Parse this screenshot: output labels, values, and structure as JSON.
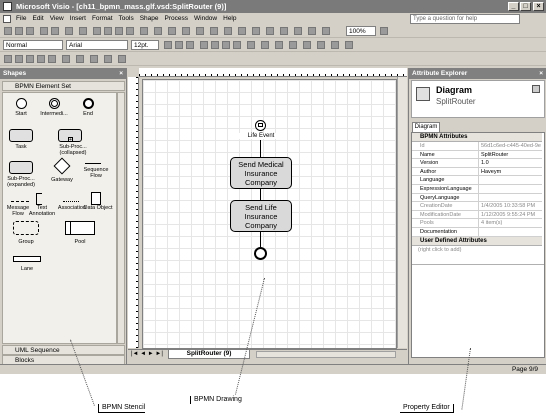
{
  "window": {
    "title": "Microsoft Visio - [ch11_bpmn_mass.glf.vsd:SplitRouter (9)]",
    "help_placeholder": "Type a question for help"
  },
  "menu": [
    "File",
    "Edit",
    "View",
    "Insert",
    "Format",
    "Tools",
    "Shape",
    "Process",
    "Window",
    "Help"
  ],
  "toolbar": {
    "style_value": "Normal",
    "font_value": "Arial",
    "size_value": "12pt.",
    "zoom_value": "100%"
  },
  "shapes_panel": {
    "title": "Shapes",
    "stencil_name": "BPMN Element Set",
    "items": {
      "start": "Start",
      "intermediate": "Intermedi...",
      "end": "End",
      "task": "Task",
      "subproc_collapsed": "Sub-Proc... (collapsed)",
      "subproc_expanded": "Sub-Proc... (expanded)",
      "gateway": "Gateway",
      "sequence_flow": "Sequence Flow",
      "message_flow": "Message Flow",
      "text_annotation": "Text Annotation",
      "association": "Association",
      "data_object": "Data Object",
      "group": "Group",
      "pool": "Pool",
      "lane": "Lane"
    },
    "uml_sequence": "UML Sequence",
    "blocks": "Blocks"
  },
  "drawing": {
    "start_event_label": "Life Event",
    "task1": "Send Medical Insurance Company",
    "task2": "Send Life Insurance Company",
    "page_tab": "SplitRouter (9)",
    "status_page": "Page 9/9"
  },
  "attribute_explorer": {
    "title": "Attribute Explorer",
    "object_type": "Diagram",
    "object_name": "SplitRouter",
    "tab": "Diagram",
    "section1": "BPMN Attributes",
    "rows": [
      {
        "k": "Id",
        "v": "56d1c6ed-c445-40ed-9e",
        "gray": true
      },
      {
        "k": "Name",
        "v": "SplitRouter",
        "gray": false
      },
      {
        "k": "Version",
        "v": "1.0",
        "gray": false
      },
      {
        "k": "Author",
        "v": "Haveym",
        "gray": false
      },
      {
        "k": "Language",
        "v": "",
        "gray": false
      },
      {
        "k": "ExpressionLanguage",
        "v": "",
        "gray": false
      },
      {
        "k": "QueryLanguage",
        "v": "",
        "gray": false
      },
      {
        "k": "CreationDate",
        "v": "1/4/2005 10:33:58 PM",
        "gray": true
      },
      {
        "k": "ModificationDate",
        "v": "1/12/2005 9:55:24 PM",
        "gray": true
      },
      {
        "k": "Pools",
        "v": "4 item(s)",
        "gray": true
      },
      {
        "k": "Documentation",
        "v": "",
        "gray": false
      }
    ],
    "section2": "User Defined Attributes",
    "add_hint": "(right click to add)"
  },
  "callouts": {
    "stencil": "BPMN Stencil",
    "drawing": "BPMN Drawing",
    "editor": "Property Editor"
  }
}
